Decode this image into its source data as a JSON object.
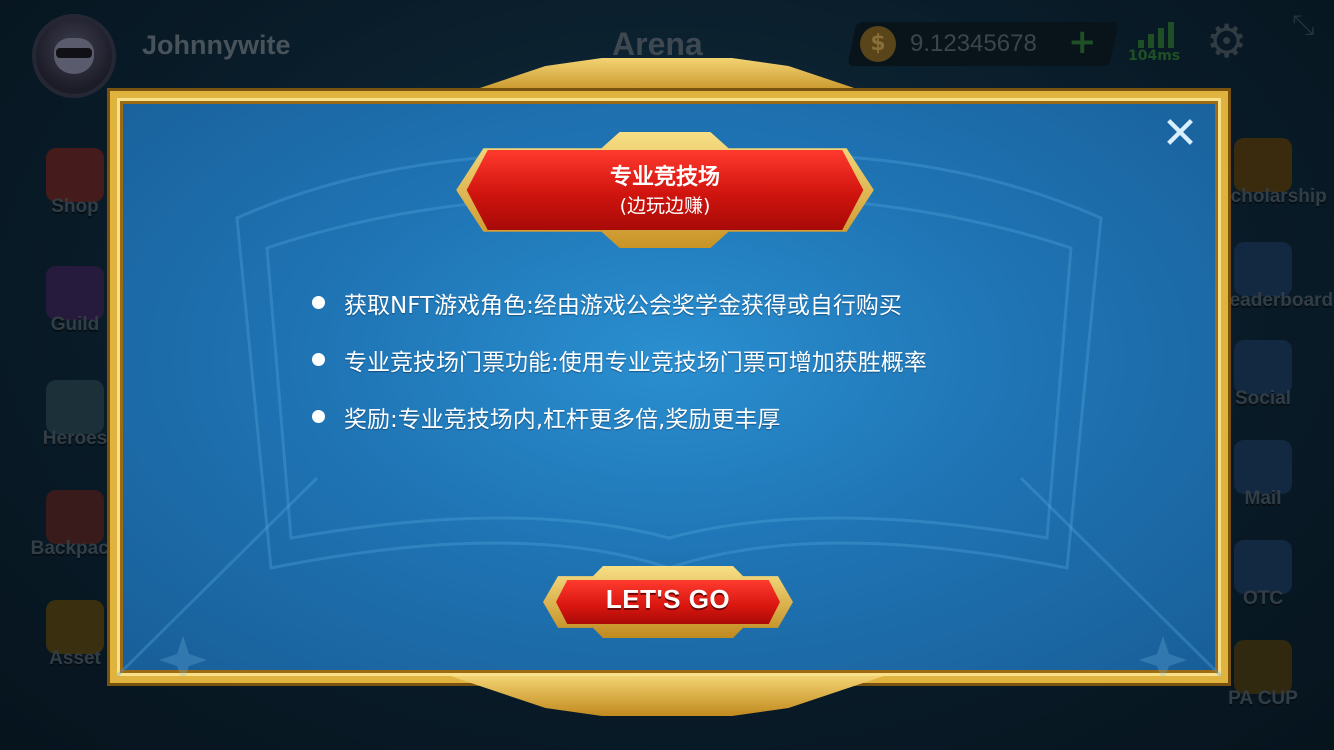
{
  "player": {
    "name": "Johnnywite"
  },
  "header": {
    "title": "Arena",
    "balance": "9.12345678",
    "add_label": "+",
    "ping": "104ms"
  },
  "left_menu": [
    {
      "label": "Shop",
      "icon": "shop-icon",
      "color": "#6b2a2a"
    },
    {
      "label": "Guild",
      "icon": "guild-banner-icon",
      "color": "#3c2a5e"
    },
    {
      "label": "Heroes",
      "icon": "helmet-icon",
      "color": "#2c4a5a"
    },
    {
      "label": "Backpack",
      "icon": "backpack-icon",
      "color": "#5a2a2a"
    },
    {
      "label": "Asset",
      "icon": "wallet-icon",
      "color": "#5a4a1a"
    }
  ],
  "right_menu": [
    {
      "label": "Scholarship",
      "icon": "scholarship-medal-icon",
      "color": "#5a4318"
    },
    {
      "label": "Leaderboard",
      "icon": "trophy-icon",
      "color": "#1e3f66"
    },
    {
      "label": "Social",
      "icon": "chat-face-icon",
      "color": "#1e3f66"
    },
    {
      "label": "Mail",
      "icon": "mail-icon",
      "color": "#1e3f66"
    },
    {
      "label": "OTC",
      "icon": "headset-icon",
      "color": "#1e3f66"
    },
    {
      "label": "PA CUP",
      "icon": "cup-emblem-icon",
      "color": "#4a3f18"
    }
  ],
  "modal": {
    "title": "专业竞技场",
    "subtitle": "(边玩边赚)",
    "rules": [
      "获取NFT游戏角色:经由游戏公会奖学金获得或自行购买",
      "专业竞技场门票功能:使用专业竞技场门票可增加获胜概率",
      "奖励:专业竞技场内,杠杆更多倍,奖励更丰厚"
    ],
    "button_label": "LET'S GO",
    "close_icon": "close-icon"
  },
  "colors": {
    "modal_blue": "#2a8fd0",
    "gold": "#e0b23e",
    "button_red": "#d8160f"
  }
}
